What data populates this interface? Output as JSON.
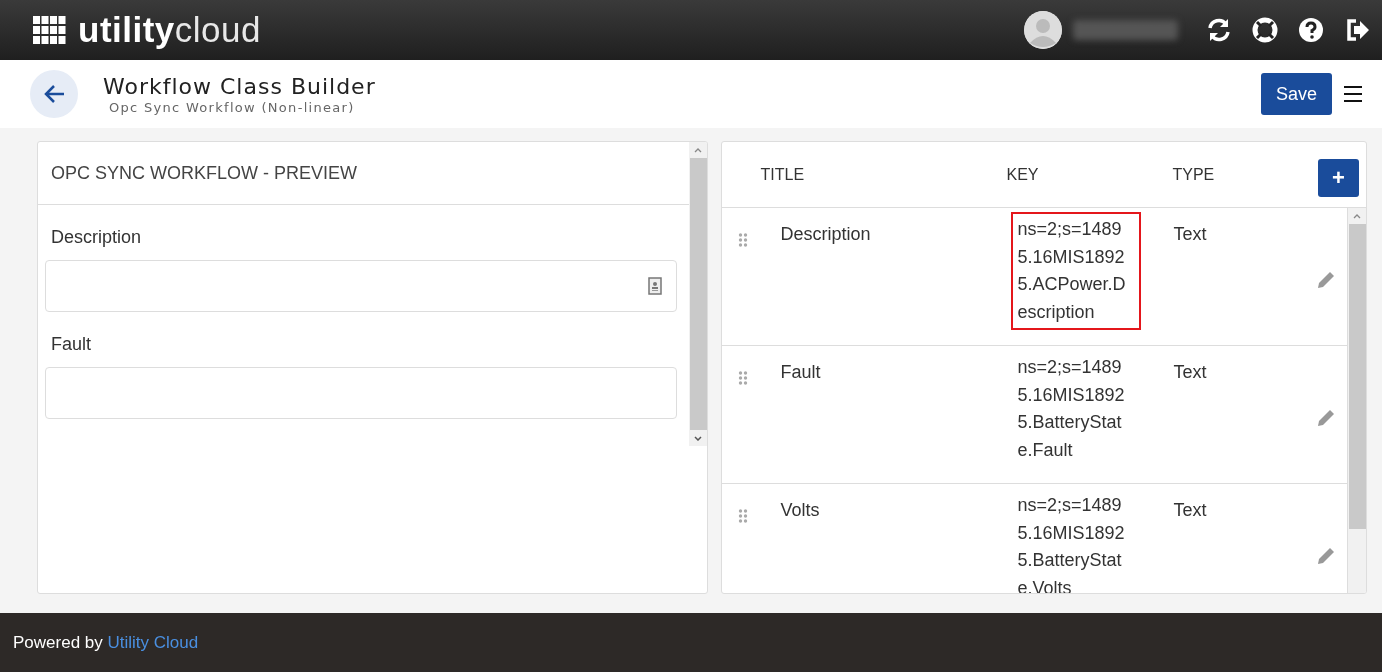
{
  "header": {
    "logo": {
      "strong": "utility",
      "light": "cloud"
    }
  },
  "page": {
    "title": "Workflow Class Builder",
    "subtitle": "Opc Sync Workflow (Non-linear)",
    "save_label": "Save"
  },
  "preview": {
    "title": "OPC SYNC WORKFLOW - PREVIEW",
    "fields": [
      {
        "label": "Description",
        "kind": "with-icon"
      },
      {
        "label": "Fault",
        "kind": "plain"
      }
    ]
  },
  "table": {
    "columns": [
      "TITLE",
      "KEY",
      "TYPE"
    ],
    "add_label": "+",
    "rows": [
      {
        "title": "Description",
        "key": "ns=2;s=14895.16MIS18925.ACPower.Description",
        "type": "Text",
        "highlighted": true
      },
      {
        "title": "Fault",
        "key": "ns=2;s=14895.16MIS18925.BatteryState.Fault",
        "type": "Text",
        "highlighted": false
      },
      {
        "title": "Volts",
        "key": "ns=2;s=14895.16MIS18925.BatteryState.Volts",
        "type": "Text",
        "highlighted": false
      }
    ]
  },
  "footer": {
    "prefix": "Powered by",
    "link": "Utility Cloud"
  }
}
